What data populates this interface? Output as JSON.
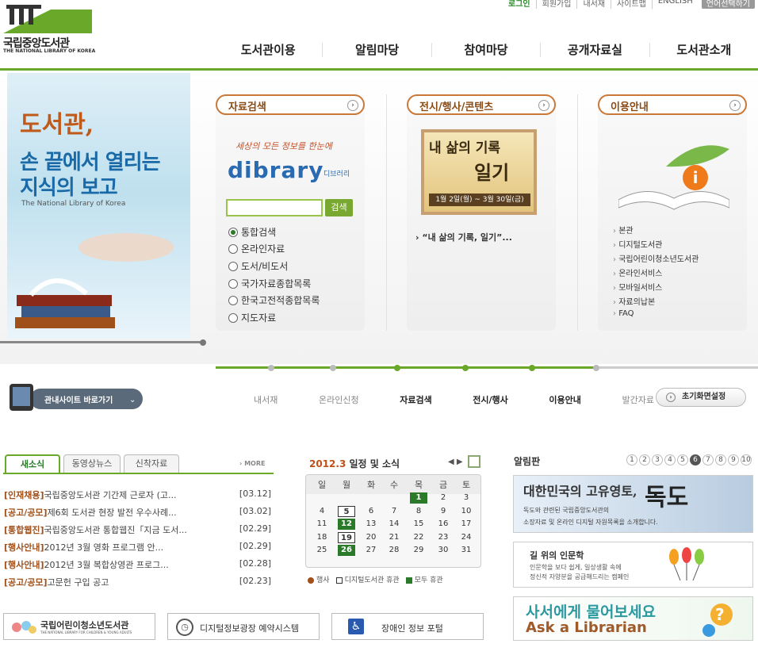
{
  "header": {
    "logo_ko": "국립중앙도서관",
    "logo_en": "THE NATIONAL LIBRARY OF KOREA",
    "util": [
      "로그인",
      "회원가입",
      "내서재",
      "사이트맵",
      "ENGLISH"
    ],
    "lang_btn": "언어선택하기",
    "gnb": [
      "도서관이용",
      "알림마당",
      "참여마당",
      "공개자료실",
      "도서관소개"
    ]
  },
  "banner": {
    "line1": "도서관,",
    "line2": "손 끝에서 열리는",
    "line3": "지식의 보고",
    "en": "The National Library of Korea"
  },
  "search_panel": {
    "title": "자료검색",
    "slogan": "세상의 모든 정보를 한눈에",
    "brand": "dibrary",
    "brand_ko": "디브러리",
    "search_btn": "검색",
    "options": [
      "통합검색",
      "온라인자료",
      "도서/비도서",
      "국가자료종합목록",
      "한국고전적종합목록",
      "지도자료"
    ],
    "selected": "통합검색"
  },
  "exhibit_panel": {
    "title": "전시/행사/콘텐츠",
    "img_t1": "내 삶의 기록",
    "img_t2": "일기",
    "img_date": "1월 2일(월) ~ 3월 30일(금)",
    "link": "“내 삶의 기록, 일기”..."
  },
  "info_panel": {
    "title": "이용안내",
    "icon": "i",
    "items": [
      "본관",
      "디지털도서관",
      "국립어린이청소년도서관",
      "온라인서비스",
      "모바일서비스",
      "자료의납본",
      "FAQ"
    ]
  },
  "quick": {
    "site_btn": "관내사이트 바로가기",
    "tabs": [
      "내서재",
      "온라인신청",
      "자료검색",
      "전시/행사",
      "이용안내",
      "발간자료"
    ],
    "active": [
      "자료검색",
      "전시/행사",
      "이용안내"
    ],
    "reset": "초기화면설정"
  },
  "news": {
    "tabs": [
      "새소식",
      "동영상뉴스",
      "신착자료"
    ],
    "more": "MORE",
    "items": [
      {
        "cat": "[인재채용]",
        "title": "국립중앙도서관 기간제 근로자 (고...",
        "date": "[03.12]"
      },
      {
        "cat": "[공고/공모]",
        "title": "제6회 도서관 현장 발전 우수사례...",
        "date": "[03.02]"
      },
      {
        "cat": "[통합웹진]",
        "title": "국립중앙도서관 통합웹진「지금 도서...",
        "date": "[02.29]"
      },
      {
        "cat": "[행사안내]",
        "title": "2012년 3월 영화 프로그램 안...",
        "date": "[02.29]"
      },
      {
        "cat": "[행사안내]",
        "title": "2012년 3월 복합상영관 프로그...",
        "date": "[02.28]"
      },
      {
        "cat": "[공고/공모]",
        "title": "고문헌 구입 공고",
        "date": "[02.23]"
      }
    ]
  },
  "calendar": {
    "ym": "2012.3",
    "title": "일정 및 소식",
    "nav": "◀ ▶",
    "days": [
      "일",
      "월",
      "화",
      "수",
      "목",
      "금",
      "토"
    ],
    "weeks": [
      [
        "",
        "",
        "",
        "",
        "1",
        "2",
        "3"
      ],
      [
        "4",
        "5",
        "6",
        "7",
        "8",
        "9",
        "10"
      ],
      [
        "11",
        "12",
        "13",
        "14",
        "15",
        "16",
        "17"
      ],
      [
        "18",
        "19",
        "20",
        "21",
        "22",
        "23",
        "24"
      ],
      [
        "25",
        "26",
        "27",
        "28",
        "29",
        "30",
        "31"
      ]
    ],
    "event_days": [
      "1",
      "12",
      "26"
    ],
    "boxed_days": [
      "5",
      "19"
    ],
    "legend": [
      "행사",
      "디지털도서관 휴관",
      "모두 휴관"
    ]
  },
  "board": {
    "title": "알림판",
    "pages": [
      "1",
      "2",
      "3",
      "4",
      "5",
      "6",
      "7",
      "8",
      "9",
      "10"
    ],
    "current": "6",
    "dokdo_t": "대한민국의 고유영토,",
    "dokdo_big": "독도",
    "dokdo_s1": "독도와 관련된 국립중앙도서관의",
    "dokdo_s2": "소장자료 및 온라인 디지털 자원목록을 소개합니다.",
    "human_t": "길 위의 인문학",
    "human_s1": "인문학을 보다 쉽게, 일상생활 속에",
    "human_s2": "정신적 자양분을 공급해드리는 캠페인",
    "ask_t1": "사서에게 물어보세요",
    "ask_t2": "Ask a Librarian"
  },
  "bottom_links": {
    "children_ko": "국립어린이청소년도서관",
    "children_en": "THE NATIONAL LIBRARY FOR CHILDREN & YOUNG ADULTS",
    "digital": "디지털정보광장 예약시스템",
    "disabled": "장애인 정보 포털"
  },
  "colors": {
    "accent": "#6aa82a",
    "panel_title": "#8a4a14",
    "event": "#2a7a2a"
  }
}
